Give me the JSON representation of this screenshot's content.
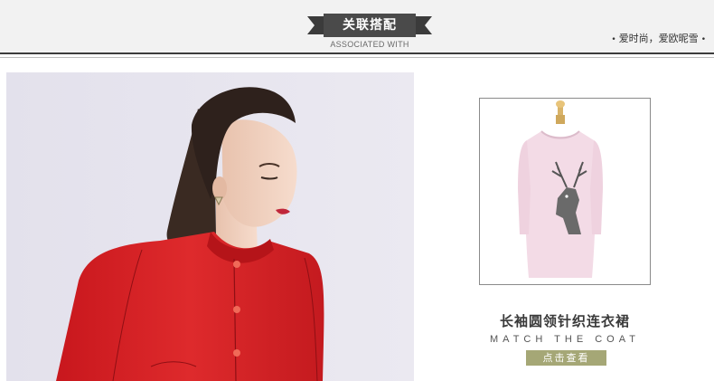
{
  "header": {
    "title": "关联搭配",
    "subtitle": "ASSOCIATED WITH",
    "slogan": "爱时尚，爱欧昵雪",
    "dot_symbol": "•"
  },
  "product": {
    "name": "长袖圆领针织连衣裙",
    "english": "MATCH THE COAT",
    "button_label": "点击查看"
  },
  "colors": {
    "header_bg": "#f2f2f2",
    "ribbon": "#3b3b3b",
    "coat_red": "#d9282a",
    "dress_pink": "#f3dbe6",
    "button": "#a5a776"
  }
}
